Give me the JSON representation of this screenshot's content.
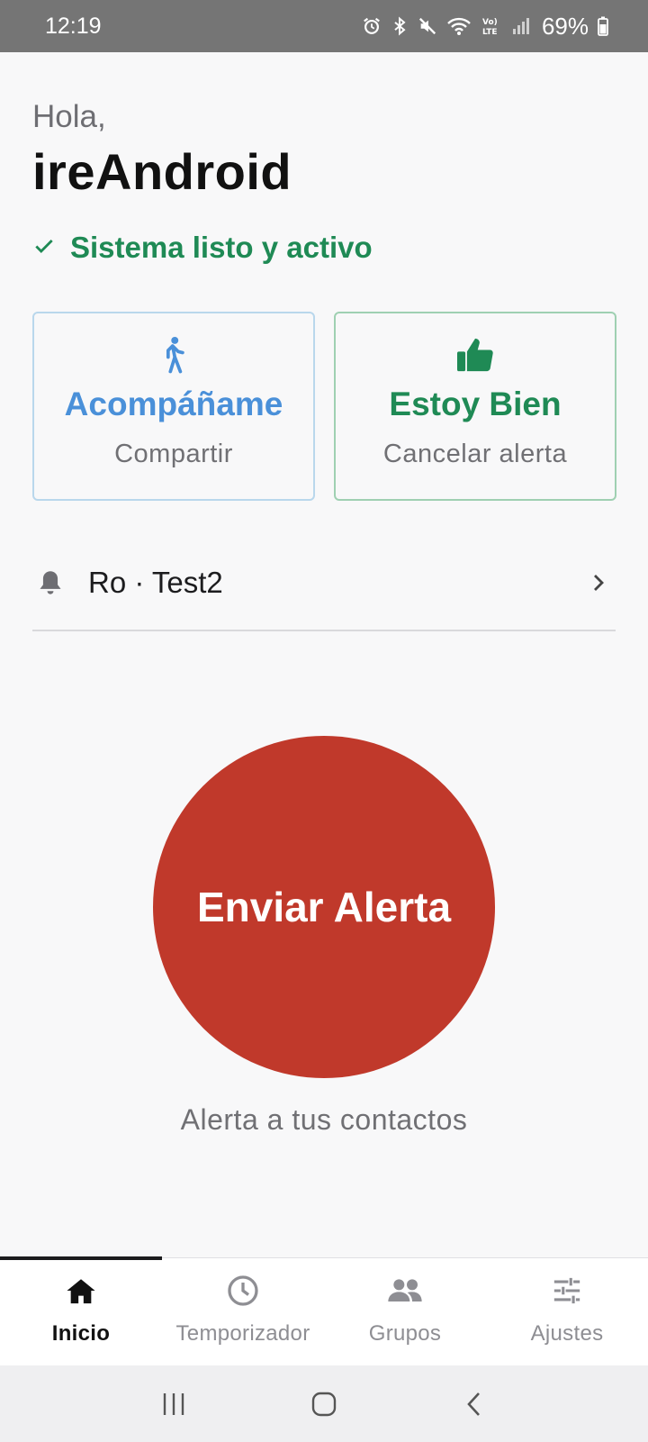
{
  "status_bar": {
    "time": "12:19",
    "battery": "69%",
    "icons": [
      "alarm-icon",
      "bluetooth-icon",
      "mute-icon",
      "wifi-icon",
      "volte-icon",
      "signal-icon",
      "battery-icon"
    ]
  },
  "greeting": {
    "hello": "Hola,",
    "username": "ireAndroid"
  },
  "system_status": {
    "icon": "check-icon",
    "text": "Sistema listo y activo",
    "color": "#1f8a55"
  },
  "cards": [
    {
      "icon": "walking-person-icon",
      "title": "Acompáñame",
      "subtitle": "Compartir",
      "color": "#4a90d9"
    },
    {
      "icon": "thumbs-up-icon",
      "title": "Estoy Bien",
      "subtitle": "Cancelar alerta",
      "color": "#1f8a55"
    }
  ],
  "group": {
    "icon": "bell-icon",
    "label": "Ro · Test2"
  },
  "alert": {
    "button_label": "Enviar Alerta",
    "caption": "Alerta a tus contactos",
    "color": "#c0392b"
  },
  "bottom_nav": {
    "items": [
      {
        "label": "Inicio",
        "icon": "home-icon",
        "active": true
      },
      {
        "label": "Temporizador",
        "icon": "clock-icon",
        "active": false
      },
      {
        "label": "Grupos",
        "icon": "group-icon",
        "active": false
      },
      {
        "label": "Ajustes",
        "icon": "sliders-icon",
        "active": false
      }
    ]
  },
  "system_nav": {
    "icons": [
      "recent-apps-icon",
      "home-circle-icon",
      "back-icon"
    ]
  }
}
